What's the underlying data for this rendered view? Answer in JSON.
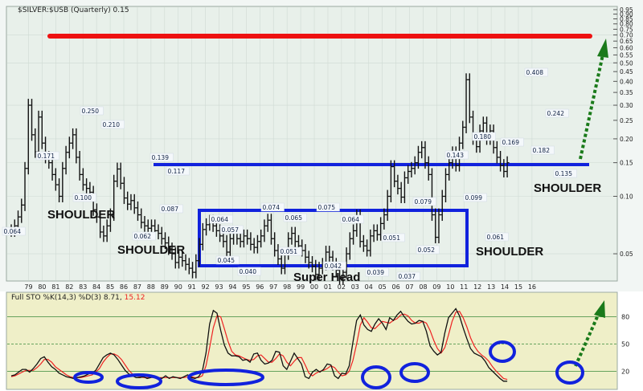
{
  "chart_data": [
    {
      "type": "ohlc",
      "title": "$SILVER:$USB (Quarterly) 0.15",
      "y_scale": "log",
      "ylim": [
        0.036,
        0.95
      ],
      "y_ticks": [
        "0.95",
        "0.90",
        "0.85",
        "0.80",
        "0.75",
        "0.70",
        "0.65",
        "0.60",
        "0.55",
        "0.50",
        "0.45",
        "0.40",
        "0.35",
        "0.30",
        "0.25",
        "0.20",
        "0.15",
        "0.10",
        "0.05"
      ],
      "x_ticks": [
        "79",
        "80",
        "81",
        "82",
        "83",
        "84",
        "85",
        "86",
        "87",
        "88",
        "89",
        "90",
        "91",
        "92",
        "93",
        "94",
        "95",
        "96",
        "97",
        "98",
        "99",
        "00",
        "01",
        "02",
        "03",
        "04",
        "05",
        "06",
        "07",
        "08",
        "09",
        "10",
        "11",
        "12",
        "13",
        "14",
        "15",
        "16"
      ],
      "close_series": [
        0.066,
        0.07,
        0.078,
        0.09,
        0.14,
        0.3,
        0.21,
        0.171,
        0.26,
        0.19,
        0.16,
        0.15,
        0.13,
        0.115,
        0.1,
        0.14,
        0.17,
        0.19,
        0.21,
        0.16,
        0.13,
        0.115,
        0.11,
        0.105,
        0.085,
        0.078,
        0.065,
        0.062,
        0.07,
        0.08,
        0.12,
        0.139,
        0.117,
        0.098,
        0.091,
        0.095,
        0.087,
        0.08,
        0.073,
        0.07,
        0.068,
        0.07,
        0.066,
        0.064,
        0.06,
        0.057,
        0.053,
        0.05,
        0.045,
        0.048,
        0.046,
        0.044,
        0.042,
        0.04,
        0.046,
        0.056,
        0.067,
        0.071,
        0.074,
        0.07,
        0.066,
        0.062,
        0.058,
        0.051,
        0.06,
        0.065,
        0.06,
        0.058,
        0.062,
        0.06,
        0.056,
        0.054,
        0.058,
        0.062,
        0.07,
        0.075,
        0.06,
        0.052,
        0.047,
        0.042,
        0.05,
        0.06,
        0.064,
        0.058,
        0.055,
        0.052,
        0.048,
        0.045,
        0.043,
        0.039,
        0.042,
        0.044,
        0.051,
        0.048,
        0.044,
        0.041,
        0.037,
        0.04,
        0.05,
        0.06,
        0.066,
        0.079,
        0.058,
        0.055,
        0.052,
        0.062,
        0.066,
        0.063,
        0.072,
        0.08,
        0.1,
        0.143,
        0.12,
        0.11,
        0.099,
        0.125,
        0.135,
        0.14,
        0.15,
        0.17,
        0.18,
        0.15,
        0.13,
        0.08,
        0.061,
        0.08,
        0.1,
        0.13,
        0.15,
        0.169,
        0.145,
        0.19,
        0.23,
        0.408,
        0.26,
        0.2,
        0.182,
        0.22,
        0.242,
        0.2,
        0.22,
        0.18,
        0.16,
        0.145,
        0.135,
        0.15
      ],
      "price_labels": [
        "0.064",
        "0.171",
        "0.250",
        "0.100",
        "0.210",
        "0.139",
        "0.062",
        "0.117",
        "0.087",
        "0.064",
        "0.057",
        "0.045",
        "0.040",
        "0.074",
        "0.065",
        "0.051",
        "0.075",
        "0.064",
        "0.042",
        "0.039",
        "0.051",
        "0.037",
        "0.079",
        "0.052",
        "0.143",
        "0.099",
        "0.180",
        "0.061",
        "0.169",
        "0.408",
        "0.182",
        "0.242",
        "0.135"
      ],
      "resistance_line": 0.72,
      "neckline": 0.14,
      "annotations": [
        "SHOULDER",
        "SHOULDER",
        "SHOULDER",
        "SHOULDER",
        "Super Head"
      ]
    },
    {
      "type": "line",
      "title": "Full STO %K(14,3) %D(3) 8.71, 15.12",
      "title_main": "Full STO %K(14,3) %D(3) 8.71,",
      "title_value": "15.12",
      "ylim": [
        0,
        100
      ],
      "y_ticks": [
        "80",
        "50",
        "20"
      ],
      "k_series": [
        15,
        16,
        19,
        22,
        22,
        19,
        23,
        28,
        34,
        36,
        30,
        25,
        22,
        18,
        16,
        14,
        13,
        12,
        13,
        14,
        15,
        17,
        18,
        21,
        28,
        35,
        38,
        40,
        38,
        33,
        27,
        21,
        17,
        15,
        13,
        13,
        14,
        12,
        13,
        15,
        13,
        12,
        15,
        12,
        14,
        13,
        12,
        14,
        16,
        13,
        12,
        14,
        20,
        40,
        72,
        87,
        84,
        65,
        49,
        40,
        37,
        37,
        36,
        32,
        33,
        30,
        39,
        40,
        32,
        28,
        29,
        32,
        42,
        41,
        26,
        22,
        31,
        40,
        34,
        28,
        14,
        12,
        19,
        22,
        19,
        22,
        28,
        27,
        15,
        12,
        18,
        17,
        26,
        52,
        76,
        82,
        71,
        66,
        64,
        72,
        78,
        73,
        66,
        79,
        76,
        82,
        86,
        80,
        75,
        72,
        73,
        76,
        75,
        64,
        48,
        42,
        38,
        41,
        62,
        79,
        84,
        89,
        81,
        68,
        56,
        45,
        40,
        38,
        36,
        31,
        24,
        20,
        16,
        12,
        9,
        9
      ],
      "d_series": [
        14,
        15,
        17,
        19,
        21,
        21,
        21,
        24,
        28,
        33,
        33,
        30,
        25,
        22,
        19,
        16,
        14,
        13,
        13,
        13,
        14,
        15,
        16,
        19,
        23,
        30,
        35,
        39,
        39,
        37,
        33,
        27,
        21,
        17,
        15,
        14,
        13,
        13,
        13,
        13,
        13,
        13,
        13,
        13,
        13,
        13,
        13,
        13,
        14,
        14,
        13,
        13,
        15,
        26,
        46,
        68,
        81,
        80,
        67,
        53,
        42,
        38,
        37,
        35,
        33,
        32,
        33,
        37,
        38,
        34,
        30,
        30,
        34,
        39,
        37,
        30,
        26,
        31,
        35,
        35,
        27,
        18,
        15,
        18,
        20,
        21,
        23,
        26,
        24,
        19,
        15,
        16,
        20,
        32,
        50,
        71,
        79,
        74,
        68,
        67,
        71,
        75,
        74,
        73,
        76,
        78,
        82,
        83,
        81,
        76,
        73,
        73,
        75,
        73,
        65,
        54,
        45,
        40,
        46,
        60,
        75,
        85,
        86,
        79,
        69,
        57,
        48,
        42,
        38,
        35,
        31,
        25,
        20,
        16,
        12,
        11
      ]
    }
  ]
}
